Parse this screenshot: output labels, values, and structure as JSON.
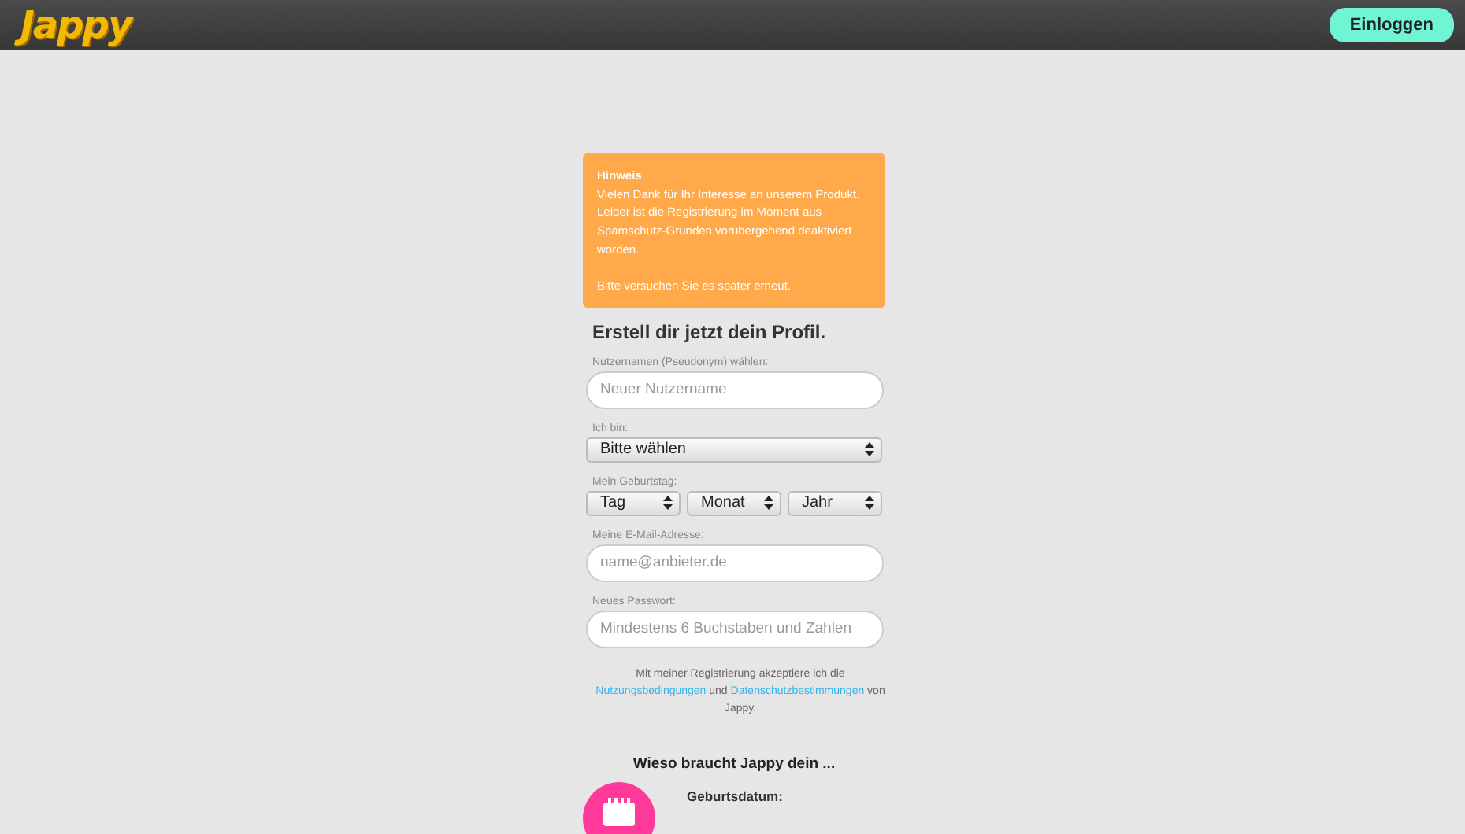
{
  "header": {
    "logo": "Jappy",
    "login_button": "Einloggen"
  },
  "notice": {
    "title": "Hinweis",
    "lines": [
      "Vielen Dank für Ihr Interesse an unserem Produkt. Leider ist die Registrierung im Moment aus Spamschutz-Gründen vorübergehend deaktiviert worden.",
      "Bitte versuchen Sie es später erneut."
    ]
  },
  "form": {
    "heading": "Erstell dir jetzt dein Profil.",
    "fields": [
      {
        "kind": "text",
        "label": "Nutzernamen (Pseudonym) wählen:",
        "placeholder": "Neuer Nutzername"
      },
      {
        "kind": "select",
        "label": "Ich bin:",
        "options": [
          "Bitte wählen"
        ]
      },
      {
        "kind": "select",
        "label": "Mein Geburtstag:",
        "options": [
          "Tag",
          "Monat",
          "Jahr"
        ]
      },
      {
        "kind": "text",
        "label": "Meine E-Mail-Adresse:",
        "placeholder": "name@anbieter.de"
      },
      {
        "kind": "text",
        "label": "Neues Passwort:",
        "placeholder": "Mindestens 6 Buchstaben und Zahlen"
      }
    ],
    "terms": {
      "before": "Mit meiner Registrierung akzeptiere ich die",
      "link_1": "Nutzungsbedingungen",
      "middle": "und",
      "link_2": "Datenschutzbestimmungen",
      "after": "von Jappy."
    }
  },
  "why": {
    "heading": "Wieso braucht Jappy dein ...",
    "items": [
      {
        "title": "Geburtsdatum:"
      }
    ]
  }
}
